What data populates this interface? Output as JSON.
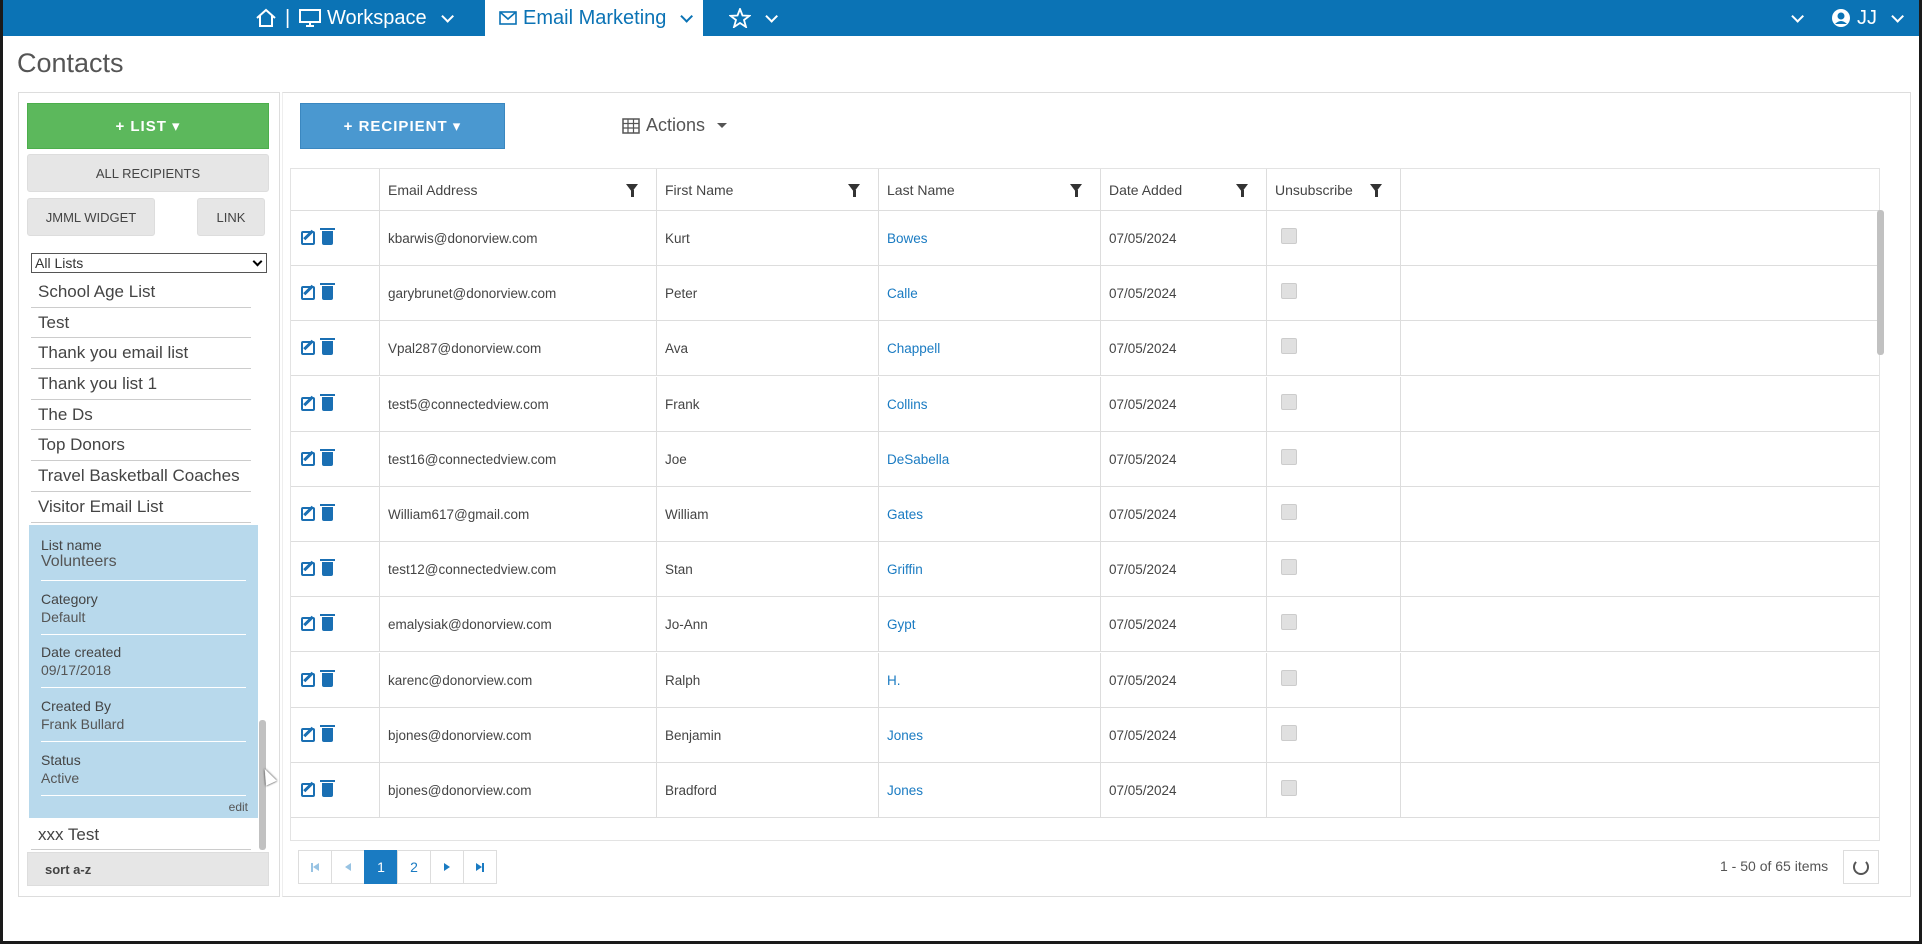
{
  "topbar": {
    "separator": "|",
    "workspace": "Workspace",
    "email_marketing": "Email Marketing",
    "user_initials": "JJ"
  },
  "page_title": "Contacts",
  "left": {
    "add_list_label": "+ LIST ▾",
    "all_recipients_label": "ALL RECIPIENTS",
    "jmml_widget_label": "JMML WIDGET",
    "link_label": "LINK",
    "list_filter_value": "All Lists",
    "lists": [
      "School Age List",
      "Test",
      "Thank you email list",
      "Thank you list 1",
      "The Ds",
      "Top Donors",
      "Travel Basketball Coaches",
      "Visitor Email List"
    ],
    "selected": {
      "list_name_label": "List name",
      "list_name": "Volunteers",
      "category_label": "Category",
      "category": "Default",
      "date_created_label": "Date created",
      "date_created": "09/17/2018",
      "created_by_label": "Created By",
      "created_by": "Frank Bullard",
      "status_label": "Status",
      "status": "Active",
      "edit_label": "edit"
    },
    "after_selected": "xxx Test",
    "sort_label": "sort a-z"
  },
  "main": {
    "add_recipient_label": "+ RECIPIENT ▾",
    "actions_label": "Actions",
    "columns": [
      "Email Address",
      "First Name",
      "Last Name",
      "Date Added",
      "Unsubscribe"
    ],
    "rows": [
      {
        "email": "kbarwis@donorview.com",
        "first": "Kurt",
        "last": "Bowes",
        "date": "07/05/2024"
      },
      {
        "email": "garybrunet@donorview.com",
        "first": "Peter",
        "last": "Calle",
        "date": "07/05/2024"
      },
      {
        "email": "Vpal287@donorview.com",
        "first": "Ava",
        "last": "Chappell",
        "date": "07/05/2024"
      },
      {
        "email": "test5@connectedview.com",
        "first": "Frank",
        "last": "Collins",
        "date": "07/05/2024"
      },
      {
        "email": "test16@connectedview.com",
        "first": "Joe",
        "last": "DeSabella",
        "date": "07/05/2024"
      },
      {
        "email": "William617@gmail.com",
        "first": "William",
        "last": "Gates",
        "date": "07/05/2024"
      },
      {
        "email": "test12@connectedview.com",
        "first": "Stan",
        "last": "Griffin",
        "date": "07/05/2024"
      },
      {
        "email": "emalysiak@donorview.com",
        "first": "Jo-Ann",
        "last": "Gypt",
        "date": "07/05/2024"
      },
      {
        "email": "karenc@donorview.com",
        "first": "Ralph",
        "last": "H.",
        "date": "07/05/2024"
      },
      {
        "email": "bjones@donorview.com",
        "first": "Benjamin",
        "last": "Jones",
        "date": "07/05/2024"
      },
      {
        "email": "bjones@donorview.com",
        "first": "Bradford",
        "last": "Jones",
        "date": "07/05/2024"
      }
    ],
    "pager": {
      "pages": [
        "1",
        "2"
      ],
      "summary": "1 - 50 of 65 items"
    }
  },
  "colors": {
    "topbar": "#0b73b5",
    "list_button": "#5cb85c",
    "recipient_button": "#4a98d0",
    "selected_list_bg": "#b8d9ec",
    "link": "#1a7bc2"
  }
}
